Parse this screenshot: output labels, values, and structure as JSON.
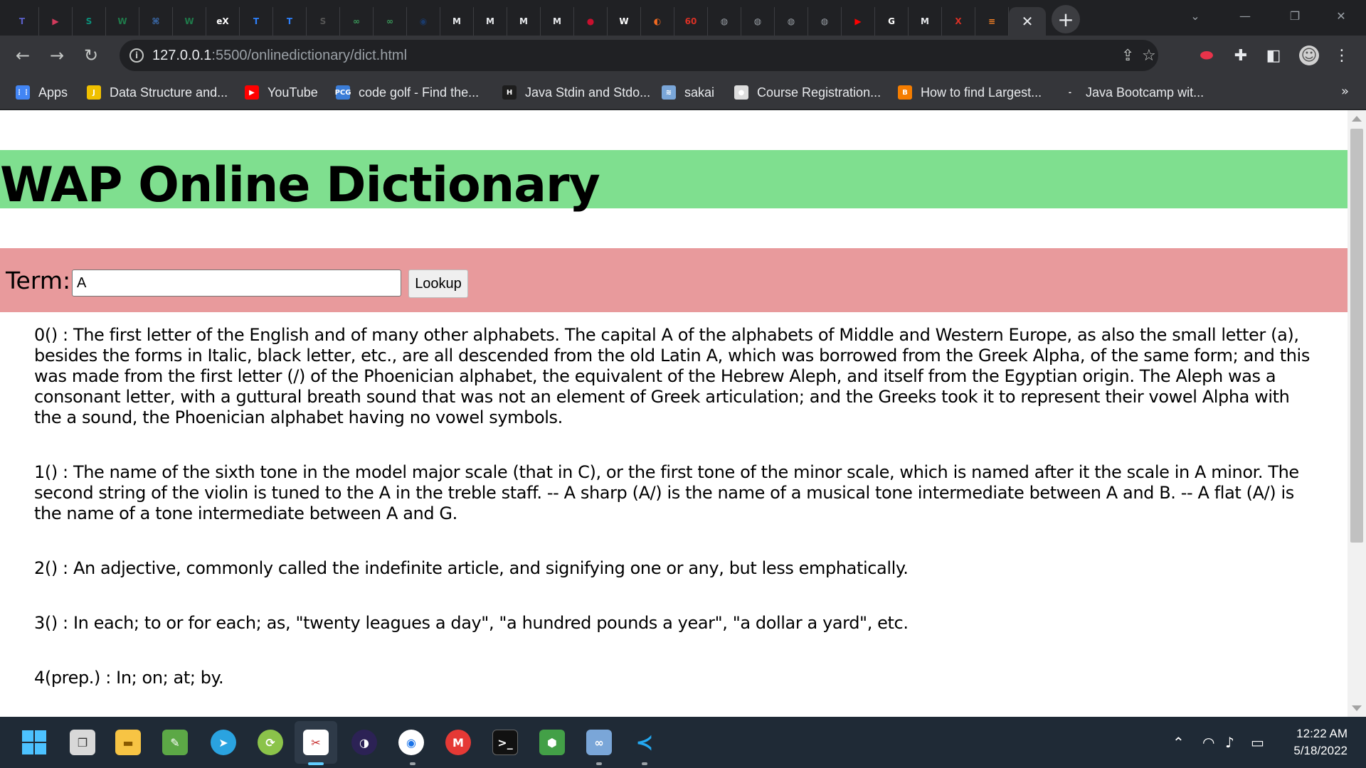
{
  "browser": {
    "tabs": [
      {
        "icon": "teams-icon",
        "glyph": "T",
        "color": "#5b5fc7"
      },
      {
        "icon": "play-icon",
        "glyph": "▶",
        "color": "#d23a5c"
      },
      {
        "icon": "skype-icon",
        "glyph": "S",
        "color": "#0b8f7a"
      },
      {
        "icon": "w-icon",
        "glyph": "W",
        "color": "#1f7a4a"
      },
      {
        "icon": "vs-icon",
        "glyph": "⌘",
        "color": "#3c6fb4"
      },
      {
        "icon": "w-icon",
        "glyph": "W",
        "color": "#1f7a4a"
      },
      {
        "icon": "ex-icon",
        "glyph": "eX",
        "color": "#ffffff"
      },
      {
        "icon": "t-icon",
        "glyph": "T",
        "color": "#2d7ff9"
      },
      {
        "icon": "t-icon",
        "glyph": "T",
        "color": "#2d7ff9"
      },
      {
        "icon": "s-icon",
        "glyph": "S",
        "color": "#555555"
      },
      {
        "icon": "infinity-icon",
        "glyph": "∞",
        "color": "#3a9a5a"
      },
      {
        "icon": "infinity-icon",
        "glyph": "∞",
        "color": "#3a9a5a"
      },
      {
        "icon": "globe-icon",
        "glyph": "◉",
        "color": "#1a3a6a"
      },
      {
        "icon": "m-icon",
        "glyph": "M",
        "color": "#e8eaed"
      },
      {
        "icon": "m-icon",
        "glyph": "M",
        "color": "#e8eaed"
      },
      {
        "icon": "m-icon",
        "glyph": "M",
        "color": "#e8eaed"
      },
      {
        "icon": "m-icon",
        "glyph": "M",
        "color": "#e8eaed"
      },
      {
        "icon": "red-badge-icon",
        "glyph": "●",
        "color": "#c8102e"
      },
      {
        "icon": "wikipedia-icon",
        "glyph": "W",
        "color": "#ffffff"
      },
      {
        "icon": "orange-icon",
        "glyph": "◐",
        "color": "#f26a21"
      },
      {
        "icon": "gmail-60-icon",
        "glyph": "60",
        "color": "#d93025"
      },
      {
        "icon": "globe-icon",
        "glyph": "◍",
        "color": "#9aa0a6"
      },
      {
        "icon": "globe-icon",
        "glyph": "◍",
        "color": "#9aa0a6"
      },
      {
        "icon": "globe-icon",
        "glyph": "◍",
        "color": "#9aa0a6"
      },
      {
        "icon": "globe-icon",
        "glyph": "◍",
        "color": "#9aa0a6"
      },
      {
        "icon": "youtube-icon",
        "glyph": "▶",
        "color": "#ff0000"
      },
      {
        "icon": "google-icon",
        "glyph": "G",
        "color": "#ffffff"
      },
      {
        "icon": "m-icon",
        "glyph": "M",
        "color": "#e8eaed"
      },
      {
        "icon": "figure-icon",
        "glyph": "Ⅹ",
        "color": "#d93025"
      },
      {
        "icon": "stackoverflow-icon",
        "glyph": "≡",
        "color": "#f48024"
      }
    ],
    "active_tab_close": "✕",
    "new_tab": "+",
    "url_host": "127.0.0.1",
    "url_rest": ":5500/onlinedictionary/dict.html",
    "bookmarks": [
      {
        "label": "Apps",
        "icon": "apps-icon",
        "color": "#4285f4",
        "glyph": "⋮⋮"
      },
      {
        "label": "Data Structure and...",
        "icon": "js-icon",
        "color": "#f0c000",
        "glyph": "J"
      },
      {
        "label": "YouTube",
        "icon": "youtube-icon",
        "color": "#ff0000",
        "glyph": "▶"
      },
      {
        "label": "code golf - Find the...",
        "icon": "pcg-icon",
        "color": "#3b7dd8",
        "glyph": "PCG"
      },
      {
        "label": "Java Stdin and Stdo...",
        "icon": "hackerrank-icon",
        "color": "#1d1d1d",
        "glyph": "H"
      },
      {
        "label": "sakai",
        "icon": "sakai-icon",
        "color": "#7aa6d8",
        "glyph": "≋"
      },
      {
        "label": "Course Registration...",
        "icon": "course-icon",
        "color": "#dddddd",
        "glyph": "●"
      },
      {
        "label": "How to find Largest...",
        "icon": "blogger-icon",
        "color": "#f57d00",
        "glyph": "B"
      },
      {
        "label": "Java Bootcamp wit...",
        "icon": "bootcamp-icon",
        "color": "#35363a",
        "glyph": "-"
      }
    ],
    "bookmarks_more": "»"
  },
  "page": {
    "title": "WAP Online Dictionary",
    "term_label": "Term:",
    "term_value": "A",
    "lookup_label": "Lookup",
    "definitions": [
      "0() : The first letter of the English and of many other alphabets. The capital A of the alphabets of Middle and Western Europe, as also the small letter (a), besides the forms in Italic, black letter, etc., are all descended from the old Latin A, which was borrowed from the Greek Alpha, of the same form; and this was made from the first letter (/) of the Phoenician alphabet, the equivalent of the Hebrew Aleph, and itself from the Egyptian origin. The Aleph was a consonant letter, with a guttural breath sound that was not an element of Greek articulation; and the Greeks took it to represent their vowel Alpha with the a sound, the Phoenician alphabet having no vowel symbols.",
      "1() : The name of the sixth tone in the model major scale (that in C), or the first tone of the minor scale, which is named after it the scale in A minor. The second string of the violin is tuned to the A in the treble staff. -- A sharp (A/) is the name of a musical tone intermediate between A and B. -- A flat (A/) is the name of a tone intermediate between A and G.",
      "2() : An adjective, commonly called the indefinite article, and signifying one or any, but less emphatically.",
      "3() : In each; to or for each; as, \"twenty leagues a day\", \"a hundred pounds a year\", \"a dollar a yard\", etc.",
      "4(prep.) : In; on; at; by."
    ]
  },
  "taskbar": {
    "time": "12:22 AM",
    "date": "5/18/2022"
  }
}
